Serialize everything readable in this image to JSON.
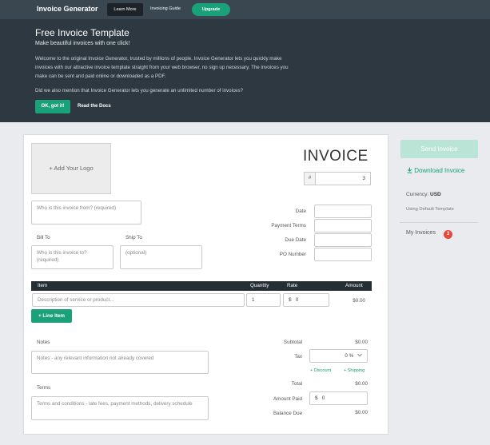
{
  "nav": {
    "brand": "Invoice Generator",
    "learn_more": "Learn More",
    "invoicing_guide": "Invoicing Guide",
    "upgrade": "Upgrade"
  },
  "hero": {
    "title": "Free Invoice Template",
    "subtitle": "Make beautiful invoices with one click!",
    "paragraph1": "Welcome to the original Invoice Generator, trusted by millions of people. Invoice Generator lets you quickly make invoices with our attractive invoice template straight from your web browser, no sign up necessary. The invoices you make can be sent and paid online or downloaded as a PDF.",
    "paragraph2": "Did we also mention that Invoice Generator lets you generate an unlimited number of invoices?",
    "ok_button": "OK, got it!",
    "docs_link": "Read the Docs"
  },
  "invoice": {
    "add_logo": "+ Add Your Logo",
    "title": "INVOICE",
    "number_prefix": "#",
    "number": "3",
    "from_placeholder": "Who is this invoice from? (required)",
    "bill_to_label": "Bill To",
    "ship_to_label": "Ship To",
    "bill_to_placeholder": "Who is this invoice to? (required)",
    "ship_to_placeholder": "(optional)",
    "date_label": "Date",
    "payment_terms_label": "Payment Terms",
    "due_date_label": "Due Date",
    "po_number_label": "PO Number",
    "table": {
      "item": "Item",
      "quantity": "Quantity",
      "rate": "Rate",
      "amount": "Amount"
    },
    "line": {
      "description_placeholder": "Description of service or product...",
      "quantity": "1",
      "rate_currency": "$",
      "rate": "0",
      "amount": "$0.00"
    },
    "line_item_button": "+ Line Item",
    "notes_label": "Notes",
    "notes_placeholder": "Notes - any relevant information not already covered",
    "terms_label": "Terms",
    "terms_placeholder": "Terms and conditions - late fees, payment methods, delivery schedule",
    "subtotal_label": "Subtotal",
    "subtotal": "$0.00",
    "tax_label": "Tax",
    "tax_value": "0 %",
    "discount_link": "+ Discount",
    "shipping_link": "+ Shipping",
    "total_label": "Total",
    "total": "$0.00",
    "amount_paid_label": "Amount Paid",
    "amount_paid_currency": "$",
    "amount_paid": "0",
    "balance_due_label": "Balance Due",
    "balance_due": "$0.00"
  },
  "sidebar": {
    "send": "Send Invoice",
    "download": "Download Invoice",
    "currency_label": "Currency:",
    "currency": "USD",
    "template": "Using Default Template",
    "my_invoices": "My Invoices",
    "invoice_count": "3"
  },
  "colors": {
    "accent": "#1aa179",
    "dark_header": "#2d3840",
    "badge": "#e8473b"
  }
}
